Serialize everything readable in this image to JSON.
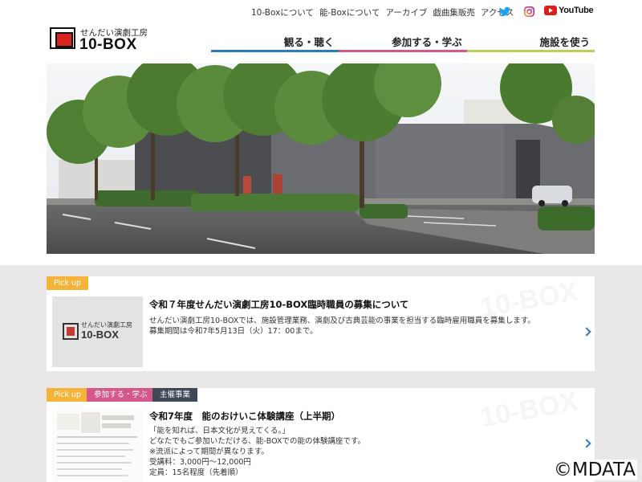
{
  "top_nav": {
    "links": [
      "10-Boxについて",
      "能-Boxについて",
      "アーカイブ",
      "戯曲集販売",
      "アクセス"
    ],
    "youtube_label": "YouTube"
  },
  "logo": {
    "sub": "せんだい演劇工房",
    "main": "10-BOX"
  },
  "main_nav": [
    "観る・聴く",
    "参加する・学ぶ",
    "施設を使う"
  ],
  "cards": [
    {
      "tags": [
        "Pick up"
      ],
      "thumb": {
        "sub": "せんだい演劇工房",
        "main": "10-BOX"
      },
      "title": "令和７年度せんだい演劇工房10-BOX臨時職員の募集について",
      "body": [
        "せんだい演劇工房10-BOXでは、施設管理業務、演劇及び古典芸能の事業を担当する臨時雇用職員を募集します。",
        "募集期間は令和7年5月13日（火）17：00まで。"
      ],
      "watermark": "10-BOX"
    },
    {
      "tags": [
        "Pick up",
        "参加する・学ぶ",
        "主催事業"
      ],
      "title": "令和7年度　能のおけいこ体験講座（上半期）",
      "body": [
        "「能を知れば、日本文化が見えてくる。」",
        "どなたでもご参加いただける、能-BOXでの能の体験講座です。",
        "※流派によって期間が異なります。",
        "受講料：3,000円～12,000円",
        "定員：15名程度（先着順）"
      ],
      "watermark": "10-BOX"
    }
  ],
  "copyright": "©MDATA",
  "colors": {
    "blue": "#2b7bb9",
    "pink": "#d6588a",
    "green": "#b9d35a",
    "orange": "#f5b33a",
    "navy": "#3e4955"
  }
}
